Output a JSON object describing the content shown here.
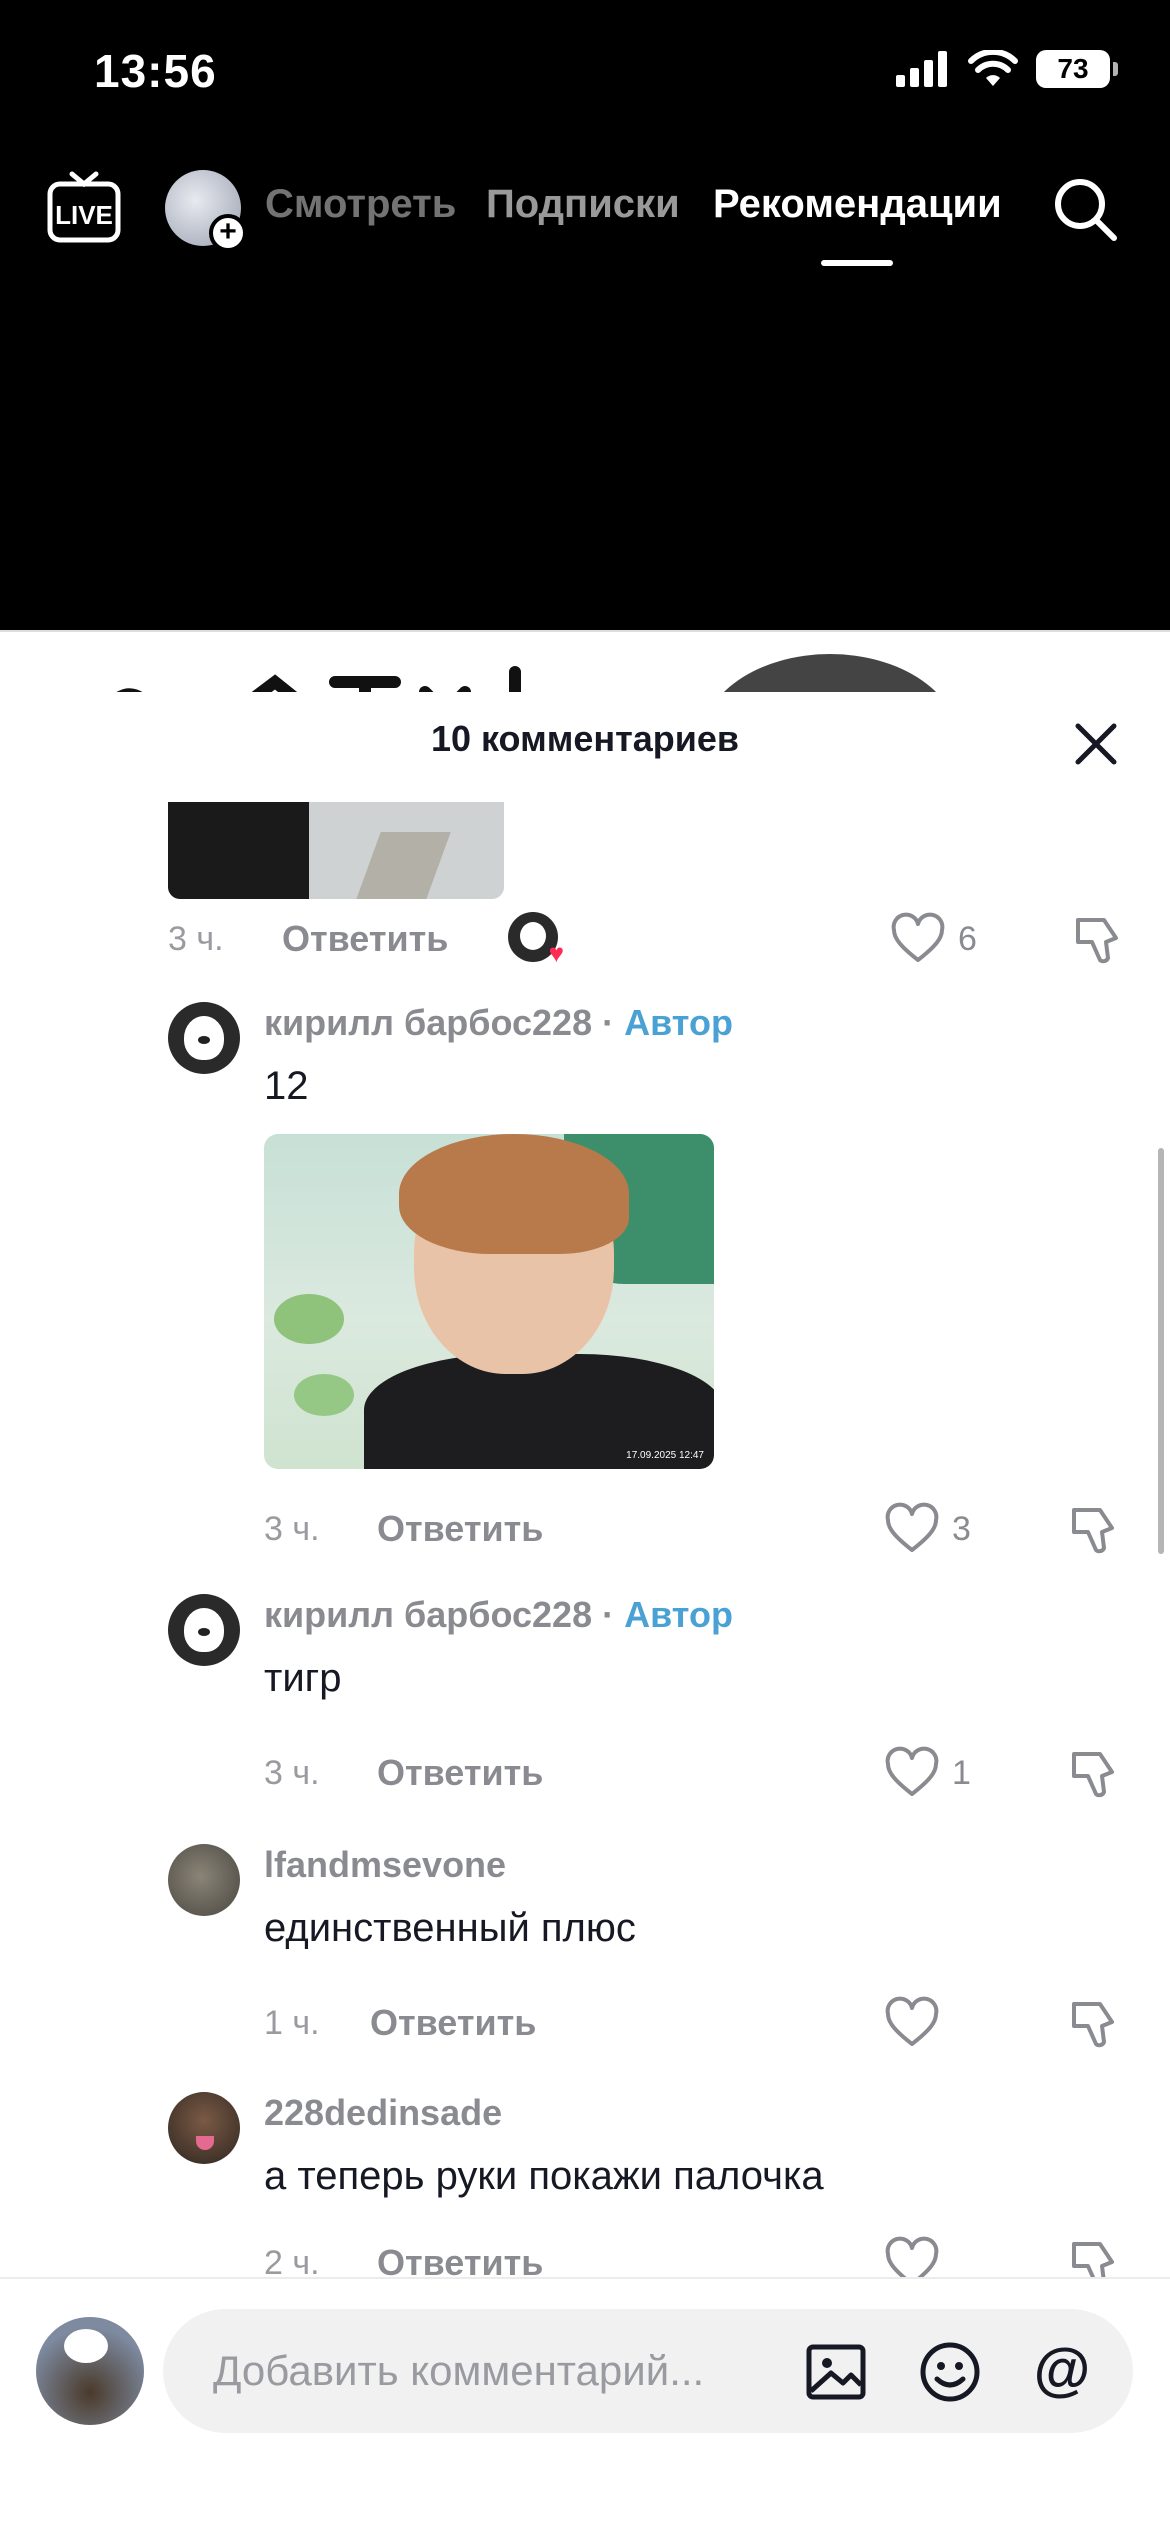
{
  "status_bar": {
    "time": "13:56",
    "battery": "73"
  },
  "nav": {
    "tabs": [
      {
        "label": "Смотреть"
      },
      {
        "label": "Подписки"
      },
      {
        "label": "Рекомендации"
      }
    ],
    "live_label": "LIVE"
  },
  "sheet": {
    "title": "10 комментариев"
  },
  "comments": [
    {
      "time": "3 ч.",
      "reply_label": "Ответить",
      "likes": "6"
    },
    {
      "username": "кирилл барбос228",
      "separator": "·",
      "author_badge": "Автор",
      "text": "12",
      "photo_timestamp": "17.09.2025 12:47",
      "time": "3 ч.",
      "reply_label": "Ответить",
      "likes": "3"
    },
    {
      "username": "кирилл барбос228",
      "separator": "·",
      "author_badge": "Автор",
      "text": "тигр",
      "time": "3 ч.",
      "reply_label": "Ответить",
      "likes": "1"
    },
    {
      "username": "lfandmsevone",
      "text": "единственный плюс",
      "time": "1 ч.",
      "reply_label": "Ответить",
      "likes": ""
    },
    {
      "username": "228dedinsade",
      "text": "а теперь руки покажи палочка",
      "time": "2 ч.",
      "reply_label": "Ответить",
      "likes": ""
    }
  ],
  "composer": {
    "placeholder": "Добавить комментарий..."
  },
  "colors": {
    "author_badge": "#4aa2d4",
    "like_heart": "#fe2c55",
    "muted_text": "#8a8b91"
  }
}
